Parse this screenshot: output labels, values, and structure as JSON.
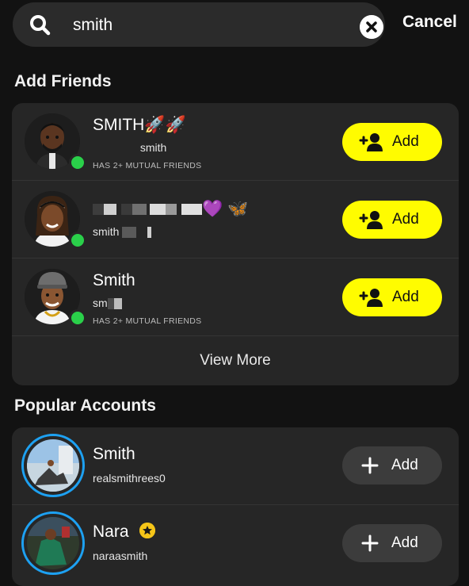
{
  "search": {
    "query": "smith",
    "cancel_label": "Cancel"
  },
  "add_friends": {
    "title": "Add Friends",
    "items": [
      {
        "name": "SMITH",
        "emoji": "🚀🚀",
        "username": "smith",
        "mutual": "HAS 2+ MUTUAL FRIENDS",
        "add_label": "Add"
      },
      {
        "name": "",
        "emoji": "💜 🦋",
        "username": "smith",
        "mutual": "",
        "add_label": "Add"
      },
      {
        "name": "Smith",
        "emoji": "",
        "username": "sm",
        "mutual": "HAS 2+ MUTUAL FRIENDS",
        "add_label": "Add"
      }
    ],
    "view_more_label": "View More"
  },
  "popular_accounts": {
    "title": "Popular Accounts",
    "items": [
      {
        "name": "Smith",
        "username": "realsmithrees0",
        "add_label": "Add"
      },
      {
        "name": "Nara",
        "username": "naraasmith",
        "add_label": "Add",
        "badge": "star-badge-icon"
      }
    ]
  },
  "colors": {
    "accent_yellow": "#fffc00",
    "online_green": "#2ad04a",
    "story_ring": "#1da1f2",
    "background": "#121212",
    "card": "#262626"
  }
}
